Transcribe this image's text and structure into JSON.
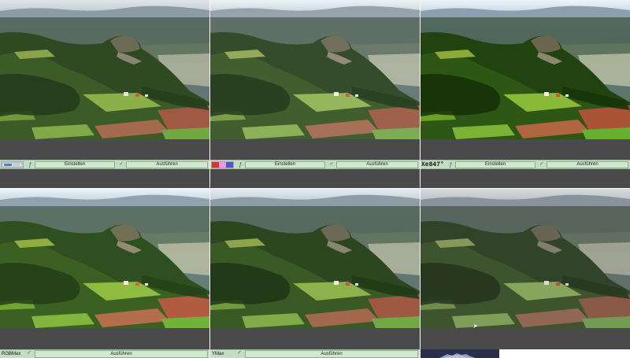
{
  "panels_top": [
    {
      "thumb_text": "",
      "buttons": {
        "create": "Einstellen",
        "run": "Ausführen"
      }
    },
    {
      "thumb_text": "",
      "buttons": {
        "create": "Einstellen",
        "run": "Ausführen"
      }
    },
    {
      "thumb_text": "Xe847°",
      "buttons": {
        "create": "Einstellen",
        "run": "Ausführen"
      }
    }
  ],
  "panels_bottom": [
    {
      "label": "RGBMax",
      "run": "Ausführen"
    },
    {
      "label": "YMax",
      "run": "Ausführen"
    },
    {
      "label": ""
    }
  ],
  "icons": {
    "filter": "filter-icon",
    "run": "run-icon",
    "thumbnail": "image-thumbnail-icon",
    "histogram": "histogram-icon",
    "cursor": "mouse-cursor-icon"
  },
  "colors": {
    "toolbar_bg": "#c3dcc3",
    "button_bg": "#cfe8cf",
    "panel_gray": "#4a4a4a"
  }
}
